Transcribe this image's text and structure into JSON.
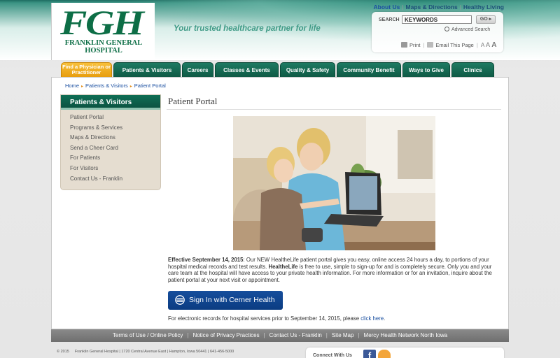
{
  "header": {
    "logo_letters": "FGH",
    "logo_name_line1": "FRANKLIN GENERAL",
    "logo_name_line2": "HOSPITAL",
    "tagline": "Your trusted healthcare partner for life",
    "top_links": [
      "About Us",
      "Maps & Directions",
      "Healthy Living"
    ],
    "search": {
      "label": "SEARCH",
      "value": "KEYWORDS",
      "go_label": "GO",
      "advanced_label": "Advanced Search"
    },
    "tools": {
      "print_label": "Print",
      "email_label": "Email This Page",
      "font_sizes": [
        "A",
        "A",
        "A"
      ]
    }
  },
  "nav": {
    "tabs": [
      {
        "label": "Find a Physician or Practitioner"
      },
      {
        "label": "Patients & Visitors"
      },
      {
        "label": "Careers"
      },
      {
        "label": "Classes & Events"
      },
      {
        "label": "Quality & Safety"
      },
      {
        "label": "Community Benefit"
      },
      {
        "label": "Ways to Give"
      },
      {
        "label": "Clinics"
      }
    ]
  },
  "breadcrumb": [
    "Home",
    "Patients & Visitors",
    "Patient Portal"
  ],
  "sidebar": {
    "title": "Patients & Visitors",
    "items": [
      "Patient Portal",
      "Programs & Services",
      "Maps & Directions",
      "Send a Cheer Card",
      "For Patients",
      "For Visitors",
      "Contact Us - Franklin"
    ]
  },
  "main": {
    "title": "Patient Portal",
    "paragraph": {
      "lead_bold": "Effective September 14, 2015",
      "text1": ": Our NEW HealtheLife patient portal gives you easy, online access 24 hours a day, to portions of your hospital medical records and test results. ",
      "brand_bold": "HealtheLife",
      "text2": " is free to use, simple to sign-up for and is completely secure. Only you and your care team at the hospital will have access to your private health information. For more information or for an invitation, inquire about the patient portal at your next visit or appointment."
    },
    "signin_label": "Sign In with Cerner Health",
    "records_text": "For electronic records for hospital services prior to September 14, 2015, please ",
    "records_link": "click here",
    "records_end": "."
  },
  "footer": {
    "links": [
      "Terms of Use / Online Policy",
      "Notice of Privacy Practices",
      "Contact Us - Franklin",
      "Site Map",
      "Mercy Health Network North Iowa"
    ],
    "copyright": "© 2015",
    "address": "Franklin General Hospital | 1720 Central Avenue East | Hampton, Iowa 50441 | 641-456-5000",
    "connect_label": "Connect With Us"
  },
  "colors": {
    "brand_green": "#0d6e46",
    "nav_green": "#0f5a45",
    "nav_highlight": "#e79d0e",
    "link_blue": "#1a4fa0",
    "button_blue": "#0b3c82"
  }
}
